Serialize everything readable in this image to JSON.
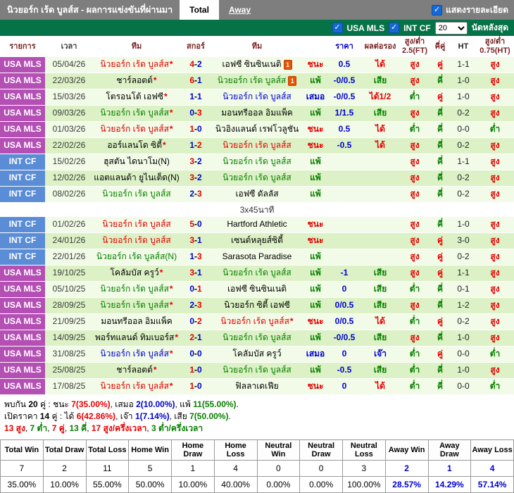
{
  "titlebar": {
    "title": "นิวยอร์ก เร้ด บูลส์ส - ผลการแข่งขันที่ผ่านมา",
    "tabs": [
      {
        "label": "Total",
        "active": true
      },
      {
        "label": "Away",
        "active": false
      }
    ],
    "detail_checkbox_label": "แสดงรายละเอียด",
    "checkbox_color": "#1668d6"
  },
  "filterbar": {
    "leagues": [
      {
        "label": "USA MLS",
        "checked": true
      },
      {
        "label": "INT CF",
        "checked": true
      }
    ],
    "match_count": "20",
    "suffix_label": "นัดหลังสุด",
    "bar_color": "#067247"
  },
  "table": {
    "headers": [
      "รายการ",
      "เวลา",
      "ทีม",
      "สกอร์",
      "ทีม",
      "",
      "ราคา",
      "ผลต่อรอง",
      "สูง/ต่ำ 2.5(FT)",
      "คี่คู่",
      "HT",
      "สูง/ต่ำ 0.75(HT)"
    ],
    "separator": "3x45นาที",
    "league_colors": {
      "mls": "#b44fb4",
      "intcf": "#5b8dd6"
    },
    "rows": [
      {
        "lg": "USA MLS",
        "lt": "mls",
        "d": "05/04/26",
        "h": {
          "t": "นิวยอร์ก เร้ด บูลส์ส",
          "c": "r",
          "star": 1
        },
        "s": {
          "h": "4",
          "hc": "r",
          "a": "2",
          "ac": "b"
        },
        "a": {
          "t": "เอฟซี ซินซินเนติ",
          "c": "k",
          "card": 1
        },
        "res": {
          "t": "ชนะ",
          "c": "r"
        },
        "pr": "0.5",
        "hd": {
          "t": "ได้",
          "c": "r"
        },
        "ou": {
          "t": "สูง",
          "c": "r"
        },
        "oe": {
          "t": "คู่",
          "c": "r"
        },
        "ht": "1-1",
        "oh": {
          "t": "สูง",
          "c": "r"
        },
        "sep": 0
      },
      {
        "lg": "USA MLS",
        "lt": "mls",
        "d": "22/03/26",
        "h": {
          "t": "ชาร์ลอตต์",
          "c": "k",
          "star": 1
        },
        "s": {
          "h": "6",
          "hc": "r",
          "a": "1",
          "ac": "b"
        },
        "a": {
          "t": "นิวยอร์ก เร้ด บูลส์ส",
          "c": "g",
          "card": 1
        },
        "res": {
          "t": "แพ้",
          "c": "g"
        },
        "pr": "-0/0.5",
        "hd": {
          "t": "เสีย",
          "c": "g"
        },
        "ou": {
          "t": "สูง",
          "c": "r"
        },
        "oe": {
          "t": "คี่",
          "c": "g"
        },
        "ht": "1-0",
        "oh": {
          "t": "สูง",
          "c": "r"
        },
        "sep": 0
      },
      {
        "lg": "USA MLS",
        "lt": "mls",
        "d": "15/03/26",
        "h": {
          "t": "โตรอนโต้ เอฟซี",
          "c": "k",
          "star": 1
        },
        "s": {
          "h": "1",
          "hc": "b",
          "a": "1",
          "ac": "b"
        },
        "a": {
          "t": "นิวยอร์ก เร้ด บูลส์ส",
          "c": "b"
        },
        "res": {
          "t": "เสมอ",
          "c": "b"
        },
        "pr": "-0/0.5",
        "hd": {
          "t": "ได้1/2",
          "c": "r"
        },
        "ou": {
          "t": "ต่ำ",
          "c": "g"
        },
        "oe": {
          "t": "คู่",
          "c": "r"
        },
        "ht": "1-0",
        "oh": {
          "t": "สูง",
          "c": "r"
        },
        "sep": 0
      },
      {
        "lg": "USA MLS",
        "lt": "mls",
        "d": "09/03/26",
        "h": {
          "t": "นิวยอร์ก เร้ด บูลส์ส",
          "c": "g",
          "star": 1
        },
        "s": {
          "h": "0",
          "hc": "b",
          "a": "3",
          "ac": "r"
        },
        "a": {
          "t": "มอนทรีออล อิมแพ็ค",
          "c": "k"
        },
        "res": {
          "t": "แพ้",
          "c": "g"
        },
        "pr": "1/1.5",
        "hd": {
          "t": "เสีย",
          "c": "g"
        },
        "ou": {
          "t": "สูง",
          "c": "r"
        },
        "oe": {
          "t": "คี่",
          "c": "g"
        },
        "ht": "0-2",
        "oh": {
          "t": "สูง",
          "c": "r"
        },
        "sep": 0
      },
      {
        "lg": "USA MLS",
        "lt": "mls",
        "d": "01/03/26",
        "h": {
          "t": "นิวยอร์ก เร้ด บูลส์ส",
          "c": "r",
          "star": 1
        },
        "s": {
          "h": "1",
          "hc": "r",
          "a": "0",
          "ac": "b"
        },
        "a": {
          "t": "นิวอิงแลนด์ เรฟโวลูชัน",
          "c": "k"
        },
        "res": {
          "t": "ชนะ",
          "c": "r"
        },
        "pr": "0.5",
        "hd": {
          "t": "ได้",
          "c": "r"
        },
        "ou": {
          "t": "ต่ำ",
          "c": "g"
        },
        "oe": {
          "t": "คี่",
          "c": "g"
        },
        "ht": "0-0",
        "oh": {
          "t": "ต่ำ",
          "c": "g"
        },
        "sep": 0
      },
      {
        "lg": "USA MLS",
        "lt": "mls",
        "d": "22/02/26",
        "h": {
          "t": "ออร์แลนโด ซิตี้",
          "c": "k",
          "star": 1
        },
        "s": {
          "h": "1",
          "hc": "b",
          "a": "2",
          "ac": "r"
        },
        "a": {
          "t": "นิวยอร์ก เร้ด บูลส์ส",
          "c": "r"
        },
        "res": {
          "t": "ชนะ",
          "c": "r"
        },
        "pr": "-0.5",
        "hd": {
          "t": "ได้",
          "c": "r"
        },
        "ou": {
          "t": "สูง",
          "c": "r"
        },
        "oe": {
          "t": "คี่",
          "c": "g"
        },
        "ht": "0-2",
        "oh": {
          "t": "สูง",
          "c": "r"
        },
        "sep": 0
      },
      {
        "lg": "INT CF",
        "lt": "intcf",
        "d": "15/02/26",
        "h": {
          "t": "ฮุสตัน ไดนาโม(N)",
          "c": "k"
        },
        "s": {
          "h": "3",
          "hc": "r",
          "a": "2",
          "ac": "b"
        },
        "a": {
          "t": "นิวยอร์ก เร้ด บูลส์ส",
          "c": "g"
        },
        "res": {
          "t": "แพ้",
          "c": "g"
        },
        "pr": "",
        "hd": {
          "t": "",
          "c": "k"
        },
        "ou": {
          "t": "สูง",
          "c": "r"
        },
        "oe": {
          "t": "คี่",
          "c": "g"
        },
        "ht": "1-1",
        "oh": {
          "t": "สูง",
          "c": "r"
        },
        "sep": 0
      },
      {
        "lg": "INT CF",
        "lt": "intcf",
        "d": "12/02/26",
        "h": {
          "t": "แอตแลนต้า ยูไนเต็ด(N)",
          "c": "k"
        },
        "s": {
          "h": "3",
          "hc": "r",
          "a": "2",
          "ac": "b"
        },
        "a": {
          "t": "นิวยอร์ก เร้ด บูลส์ส",
          "c": "g"
        },
        "res": {
          "t": "แพ้",
          "c": "g"
        },
        "pr": "",
        "hd": {
          "t": "",
          "c": "k"
        },
        "ou": {
          "t": "สูง",
          "c": "r"
        },
        "oe": {
          "t": "คี่",
          "c": "g"
        },
        "ht": "0-2",
        "oh": {
          "t": "สูง",
          "c": "r"
        },
        "sep": 0
      },
      {
        "lg": "INT CF",
        "lt": "intcf",
        "d": "08/02/26",
        "h": {
          "t": "นิวยอร์ก เร้ด บูลส์ส",
          "c": "g"
        },
        "s": {
          "h": "2",
          "hc": "b",
          "a": "3",
          "ac": "r"
        },
        "a": {
          "t": "เอฟซี ดัลลัส",
          "c": "k"
        },
        "res": {
          "t": "แพ้",
          "c": "g"
        },
        "pr": "",
        "hd": {
          "t": "",
          "c": "k"
        },
        "ou": {
          "t": "สูง",
          "c": "r"
        },
        "oe": {
          "t": "คี่",
          "c": "g"
        },
        "ht": "0-2",
        "oh": {
          "t": "สูง",
          "c": "r"
        },
        "sep": 1
      },
      {
        "lg": "INT CF",
        "lt": "intcf",
        "d": "01/02/26",
        "h": {
          "t": "นิวยอร์ก เร้ด บูลส์ส",
          "c": "r"
        },
        "s": {
          "h": "5",
          "hc": "r",
          "a": "0",
          "ac": "b"
        },
        "a": {
          "t": "Hartford Athletic",
          "c": "k"
        },
        "res": {
          "t": "ชนะ",
          "c": "r"
        },
        "pr": "",
        "hd": {
          "t": "",
          "c": "k"
        },
        "ou": {
          "t": "สูง",
          "c": "r"
        },
        "oe": {
          "t": "คี่",
          "c": "g"
        },
        "ht": "1-0",
        "oh": {
          "t": "สูง",
          "c": "r"
        },
        "sep": 0
      },
      {
        "lg": "INT CF",
        "lt": "intcf",
        "d": "24/01/26",
        "h": {
          "t": "นิวยอร์ก เร้ด บูลส์ส",
          "c": "r"
        },
        "s": {
          "h": "3",
          "hc": "r",
          "a": "1",
          "ac": "b"
        },
        "a": {
          "t": "เซนต์หลุยส์ซิตี้",
          "c": "k"
        },
        "res": {
          "t": "ชนะ",
          "c": "r"
        },
        "pr": "",
        "hd": {
          "t": "",
          "c": "k"
        },
        "ou": {
          "t": "สูง",
          "c": "r"
        },
        "oe": {
          "t": "คู่",
          "c": "r"
        },
        "ht": "3-0",
        "oh": {
          "t": "สูง",
          "c": "r"
        },
        "sep": 0
      },
      {
        "lg": "INT CF",
        "lt": "intcf",
        "d": "22/01/26",
        "h": {
          "t": "นิวยอร์ก เร้ด บูลส์ส(N)",
          "c": "g"
        },
        "s": {
          "h": "1",
          "hc": "b",
          "a": "3",
          "ac": "r"
        },
        "a": {
          "t": "Sarasota Paradise",
          "c": "k"
        },
        "res": {
          "t": "แพ้",
          "c": "g"
        },
        "pr": "",
        "hd": {
          "t": "",
          "c": "k"
        },
        "ou": {
          "t": "สูง",
          "c": "r"
        },
        "oe": {
          "t": "คู่",
          "c": "r"
        },
        "ht": "0-2",
        "oh": {
          "t": "สูง",
          "c": "r"
        },
        "sep": 0
      },
      {
        "lg": "USA MLS",
        "lt": "mls",
        "d": "19/10/25",
        "h": {
          "t": "โคลัมบัส ครูว์",
          "c": "k",
          "star": 1
        },
        "s": {
          "h": "3",
          "hc": "r",
          "a": "1",
          "ac": "b"
        },
        "a": {
          "t": "นิวยอร์ก เร้ด บูลส์ส",
          "c": "g"
        },
        "res": {
          "t": "แพ้",
          "c": "g"
        },
        "pr": "-1",
        "hd": {
          "t": "เสีย",
          "c": "g"
        },
        "ou": {
          "t": "สูง",
          "c": "r"
        },
        "oe": {
          "t": "คู่",
          "c": "r"
        },
        "ht": "1-1",
        "oh": {
          "t": "สูง",
          "c": "r"
        },
        "sep": 0
      },
      {
        "lg": "USA MLS",
        "lt": "mls",
        "d": "05/10/25",
        "h": {
          "t": "นิวยอร์ก เร้ด บูลส์ส",
          "c": "g",
          "star": 1
        },
        "s": {
          "h": "0",
          "hc": "b",
          "a": "1",
          "ac": "r"
        },
        "a": {
          "t": "เอฟซี ซินซินเนติ",
          "c": "k"
        },
        "res": {
          "t": "แพ้",
          "c": "g"
        },
        "pr": "0",
        "hd": {
          "t": "เสีย",
          "c": "g"
        },
        "ou": {
          "t": "ต่ำ",
          "c": "g"
        },
        "oe": {
          "t": "คี่",
          "c": "g"
        },
        "ht": "0-1",
        "oh": {
          "t": "สูง",
          "c": "r"
        },
        "sep": 0
      },
      {
        "lg": "USA MLS",
        "lt": "mls",
        "d": "28/09/25",
        "h": {
          "t": "นิวยอร์ก เร้ด บูลส์ส",
          "c": "g",
          "star": 1
        },
        "s": {
          "h": "2",
          "hc": "b",
          "a": "3",
          "ac": "r"
        },
        "a": {
          "t": "นิวยอร์ก ซิตี้ เอฟซี",
          "c": "k"
        },
        "res": {
          "t": "แพ้",
          "c": "g"
        },
        "pr": "0/0.5",
        "hd": {
          "t": "เสีย",
          "c": "g"
        },
        "ou": {
          "t": "สูง",
          "c": "r"
        },
        "oe": {
          "t": "คี่",
          "c": "g"
        },
        "ht": "1-2",
        "oh": {
          "t": "สูง",
          "c": "r"
        },
        "sep": 0
      },
      {
        "lg": "USA MLS",
        "lt": "mls",
        "d": "21/09/25",
        "h": {
          "t": "มอนทรีออล อิมแพ็ค",
          "c": "k"
        },
        "s": {
          "h": "0",
          "hc": "b",
          "a": "2",
          "ac": "r"
        },
        "a": {
          "t": "นิวยอร์ก เร้ด บูลส์ส",
          "c": "r",
          "star": 1
        },
        "res": {
          "t": "ชนะ",
          "c": "r"
        },
        "pr": "0/0.5",
        "hd": {
          "t": "ได้",
          "c": "r"
        },
        "ou": {
          "t": "ต่ำ",
          "c": "g"
        },
        "oe": {
          "t": "คู่",
          "c": "r"
        },
        "ht": "0-2",
        "oh": {
          "t": "สูง",
          "c": "r"
        },
        "sep": 0
      },
      {
        "lg": "USA MLS",
        "lt": "mls",
        "d": "14/09/25",
        "h": {
          "t": "พอร์ทแลนด์ ทิมเบอร์ส",
          "c": "k",
          "star": 1
        },
        "s": {
          "h": "2",
          "hc": "r",
          "a": "1",
          "ac": "b"
        },
        "a": {
          "t": "นิวยอร์ก เร้ด บูลส์ส",
          "c": "g"
        },
        "res": {
          "t": "แพ้",
          "c": "g"
        },
        "pr": "-0/0.5",
        "hd": {
          "t": "เสีย",
          "c": "g"
        },
        "ou": {
          "t": "สูง",
          "c": "r"
        },
        "oe": {
          "t": "คี่",
          "c": "g"
        },
        "ht": "1-0",
        "oh": {
          "t": "สูง",
          "c": "r"
        },
        "sep": 0
      },
      {
        "lg": "USA MLS",
        "lt": "mls",
        "d": "31/08/25",
        "h": {
          "t": "นิวยอร์ก เร้ด บูลส์ส",
          "c": "b",
          "star": 1
        },
        "s": {
          "h": "0",
          "hc": "b",
          "a": "0",
          "ac": "b"
        },
        "a": {
          "t": "โคลัมบัส ครูว์",
          "c": "k"
        },
        "res": {
          "t": "เสมอ",
          "c": "b"
        },
        "pr": "0",
        "hd": {
          "t": "เจ๊า",
          "c": "b"
        },
        "ou": {
          "t": "ต่ำ",
          "c": "g"
        },
        "oe": {
          "t": "คู่",
          "c": "r"
        },
        "ht": "0-0",
        "oh": {
          "t": "ต่ำ",
          "c": "g"
        },
        "sep": 0
      },
      {
        "lg": "USA MLS",
        "lt": "mls",
        "d": "25/08/25",
        "h": {
          "t": "ชาร์ลอตต์",
          "c": "k",
          "star": 1
        },
        "s": {
          "h": "1",
          "hc": "r",
          "a": "0",
          "ac": "b"
        },
        "a": {
          "t": "นิวยอร์ก เร้ด บูลส์ส",
          "c": "g"
        },
        "res": {
          "t": "แพ้",
          "c": "g"
        },
        "pr": "-0.5",
        "hd": {
          "t": "เสีย",
          "c": "g"
        },
        "ou": {
          "t": "ต่ำ",
          "c": "g"
        },
        "oe": {
          "t": "คี่",
          "c": "g"
        },
        "ht": "1-0",
        "oh": {
          "t": "สูง",
          "c": "r"
        },
        "sep": 0
      },
      {
        "lg": "USA MLS",
        "lt": "mls",
        "d": "17/08/25",
        "h": {
          "t": "นิวยอร์ก เร้ด บูลส์ส",
          "c": "r",
          "star": 1
        },
        "s": {
          "h": "1",
          "hc": "r",
          "a": "0",
          "ac": "b"
        },
        "a": {
          "t": "ฟิลลาเดเฟีย",
          "c": "k"
        },
        "res": {
          "t": "ชนะ",
          "c": "r"
        },
        "pr": "0",
        "hd": {
          "t": "ได้",
          "c": "r"
        },
        "ou": {
          "t": "ต่ำ",
          "c": "g"
        },
        "oe": {
          "t": "คี่",
          "c": "g"
        },
        "ht": "0-0",
        "oh": {
          "t": "ต่ำ",
          "c": "g"
        },
        "sep": 0
      }
    ]
  },
  "summary": {
    "lines": [
      [
        {
          "t": "พบกัน ",
          "c": "k"
        },
        {
          "t": "20",
          "c": "k",
          "b": 1
        },
        {
          "t": " คู่ : ชนะ ",
          "c": "k"
        },
        {
          "t": "7(35.00%)",
          "c": "r",
          "b": 1
        },
        {
          "t": ", เสมอ ",
          "c": "k"
        },
        {
          "t": "2(10.00%)",
          "c": "b",
          "b": 1
        },
        {
          "t": ", แพ้ ",
          "c": "k"
        },
        {
          "t": "11(55.00%)",
          "c": "g",
          "b": 1
        },
        {
          "t": ".",
          "c": "k"
        }
      ],
      [
        {
          "t": "เปิดราคา ",
          "c": "k"
        },
        {
          "t": "14",
          "c": "k",
          "b": 1
        },
        {
          "t": " คู่ : ได้ ",
          "c": "k"
        },
        {
          "t": "6(42.86%)",
          "c": "r",
          "b": 1
        },
        {
          "t": ", เจ๊า ",
          "c": "k"
        },
        {
          "t": "1(7.14%)",
          "c": "b",
          "b": 1
        },
        {
          "t": ", เสีย ",
          "c": "k"
        },
        {
          "t": "7(50.00%)",
          "c": "g",
          "b": 1
        },
        {
          "t": ".",
          "c": "k"
        }
      ],
      [
        {
          "t": "13 สูง",
          "c": "r",
          "b": 1
        },
        {
          "t": ", ",
          "c": "k"
        },
        {
          "t": "7 ต่ำ",
          "c": "g",
          "b": 1
        },
        {
          "t": ", ",
          "c": "k"
        },
        {
          "t": "7 คู่",
          "c": "r",
          "b": 1
        },
        {
          "t": ", ",
          "c": "k"
        },
        {
          "t": "13 คี่",
          "c": "g",
          "b": 1
        },
        {
          "t": ", ",
          "c": "k"
        },
        {
          "t": "17 สูง/ครึ่งเวลา",
          "c": "r",
          "b": 1
        },
        {
          "t": ", ",
          "c": "k"
        },
        {
          "t": "3 ต่ำ/ครึ่งเวลา",
          "c": "g",
          "b": 1
        }
      ]
    ]
  },
  "stats": {
    "headers": [
      "Total Win",
      "Total Draw",
      "Total Loss",
      "Home Win",
      "Home Draw",
      "Home Loss",
      "Neutral Win",
      "Neutral Draw",
      "Neutral Loss",
      "Away Win",
      "Away Draw",
      "Away Loss"
    ],
    "counts": [
      "7",
      "2",
      "11",
      "5",
      "1",
      "4",
      "0",
      "0",
      "3",
      "2",
      "1",
      "4"
    ],
    "percents": [
      "35.00%",
      "10.00%",
      "55.00%",
      "50.00%",
      "10.00%",
      "40.00%",
      "0.00%",
      "0.00%",
      "100.00%",
      "28.57%",
      "14.29%",
      "57.14%"
    ],
    "away_highlight_color": "#0000cc"
  }
}
